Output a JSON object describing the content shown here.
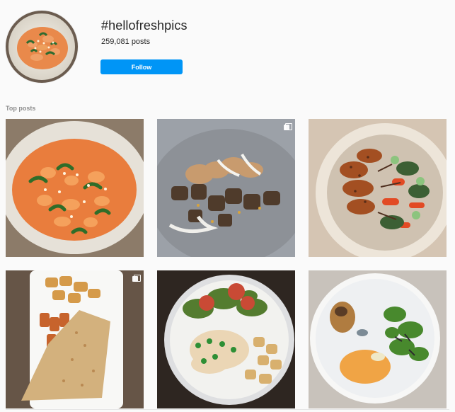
{
  "hashtag": {
    "title": "#hellofreshpics",
    "posts_label": "259,081 posts",
    "follow_label": "Follow"
  },
  "section": {
    "top_posts_label": "Top posts"
  },
  "colors": {
    "follow_bg": "#0095f6",
    "follow_text": "#ffffff",
    "page_bg": "#fafafa",
    "secondary_text": "#8e8e8e"
  },
  "posts": [
    {
      "name": "creamy-tomato-pasta",
      "multi": false
    },
    {
      "name": "chicken-potatoes-sauce",
      "multi": true
    },
    {
      "name": "grilled-chicken-vegetable-bowl",
      "multi": false
    },
    {
      "name": "breaded-fish-potatoes",
      "multi": true
    },
    {
      "name": "fish-salad-potatoes",
      "multi": false
    },
    {
      "name": "chicken-mash-salad",
      "multi": false
    }
  ]
}
